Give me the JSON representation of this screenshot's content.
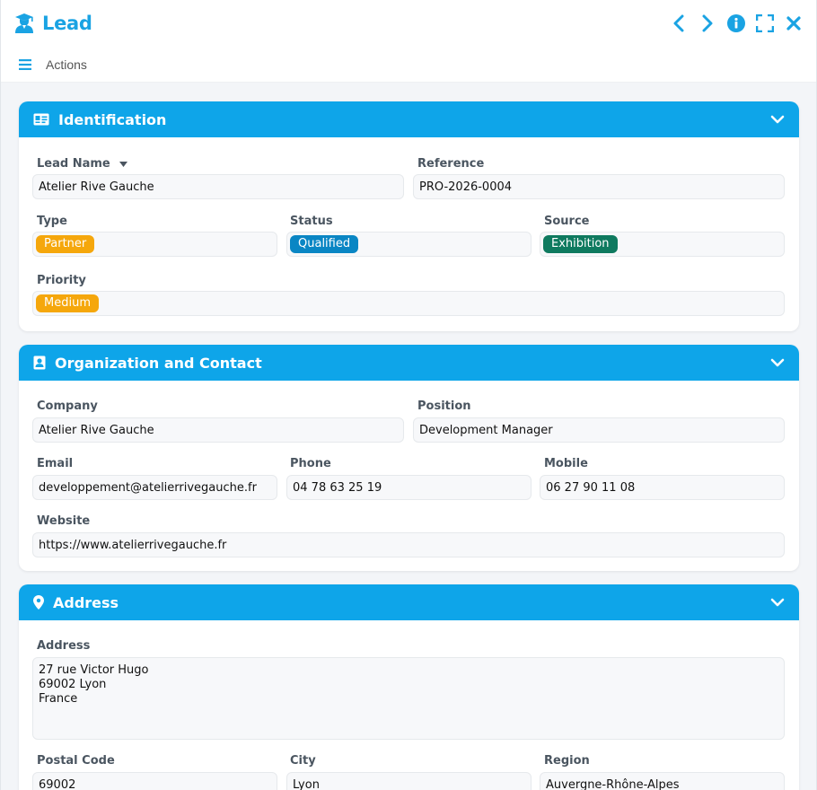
{
  "window": {
    "title": "Lead",
    "actions_label": "Actions"
  },
  "colors": {
    "accent": "#0ea5e9",
    "title": "#1aa3e3",
    "badge_partner": "#f5a70c",
    "badge_qualified": "#0a86c4",
    "badge_exhibition": "#0f7a5f",
    "badge_medium": "#f5a70c"
  },
  "icons": {
    "app": "graduate-user-icon",
    "prev": "chevron-left-icon",
    "next": "chevron-right-icon",
    "info": "info-circle-icon",
    "fullscreen": "expand-icon",
    "close": "close-icon",
    "menu": "hamburger-menu-icon"
  },
  "identification": {
    "title": "Identification",
    "lead_name_label": "Lead Name",
    "lead_name_value": "Atelier Rive Gauche",
    "reference_label": "Reference",
    "reference_value": "PRO-2026-0004",
    "type_label": "Type",
    "type_value": "Partner",
    "status_label": "Status",
    "status_value": "Qualified",
    "source_label": "Source",
    "source_value": "Exhibition",
    "priority_label": "Priority",
    "priority_value": "Medium"
  },
  "organization": {
    "title": "Organization and Contact",
    "company_label": "Company",
    "company_value": "Atelier Rive Gauche",
    "position_label": "Position",
    "position_value": "Development Manager",
    "email_label": "Email",
    "email_value": "developpement@atelierrivegauche.fr",
    "phone_label": "Phone",
    "phone_value": "04 78 63 25 19",
    "mobile_label": "Mobile",
    "mobile_value": "06 27 90 11 08",
    "website_label": "Website",
    "website_value": "https://www.atelierrivegauche.fr"
  },
  "address": {
    "title": "Address",
    "address_label": "Address",
    "address_value": "27 rue Victor Hugo\n69002 Lyon\nFrance",
    "postal_label": "Postal Code",
    "postal_value": "69002",
    "city_label": "City",
    "city_value": "Lyon",
    "region_label": "Region",
    "region_value": "Auvergne-Rhône-Alpes"
  }
}
